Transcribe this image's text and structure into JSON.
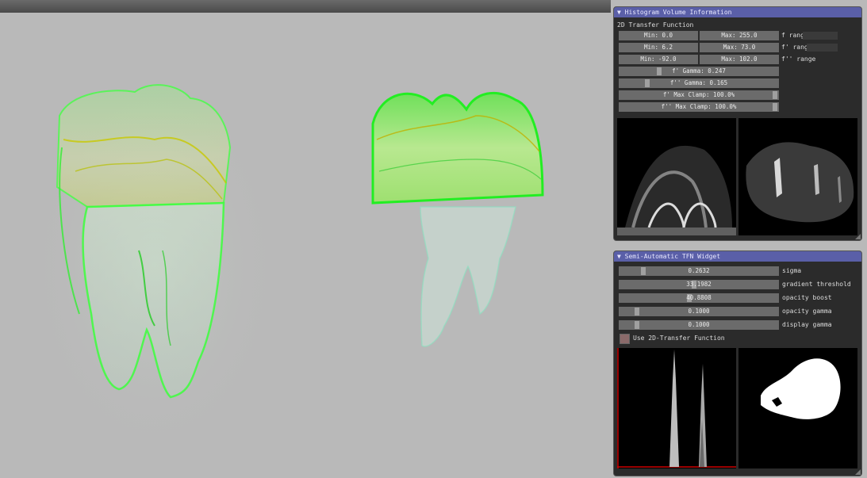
{
  "histogram_panel": {
    "title": "▼ Histogram Volume Information",
    "subtitle": "2D Transfer Function",
    "ranges": [
      {
        "min": "Min: 0.0",
        "max": "Max: 255.0",
        "label": "f  range"
      },
      {
        "min": "Min: 6.2",
        "max": "Max: 73.0",
        "label": "f' range"
      },
      {
        "min": "Min: -92.0",
        "max": "Max: 102.0",
        "label": "f'' range"
      }
    ],
    "sliders": [
      {
        "text": "f' Gamma: 0.247",
        "fraction": 0.27
      },
      {
        "text": "f'' Gamma: 0.165",
        "fraction": 0.17
      },
      {
        "text": "f' Max Clamp: 100.0%",
        "fraction": 1.0
      },
      {
        "text": "f'' Max Clamp: 100.0%",
        "fraction": 1.0
      }
    ]
  },
  "tfn_panel": {
    "title": "▼ Semi-Automatic TFN Widget",
    "params": [
      {
        "value": "0.2632",
        "label": "sigma",
        "fraction": 0.14
      },
      {
        "value": "33.1982",
        "label": "gradient threshold",
        "fraction": 0.47
      },
      {
        "value": "40.8808",
        "label": "opacity boost",
        "fraction": 0.41
      },
      {
        "value": "0.1000",
        "label": "opacity gamma",
        "fraction": 0.1
      },
      {
        "value": "0.1000",
        "label": "display gamma",
        "fraction": 0.1
      }
    ],
    "checkbox_label": "Use 2D-Transfer Function"
  },
  "colors": {
    "viewport_bg": "#b9b9b9",
    "title_bar": "#5a5fa8",
    "tooth_green": "#33ff33",
    "tooth_yellow": "#c8d000"
  }
}
